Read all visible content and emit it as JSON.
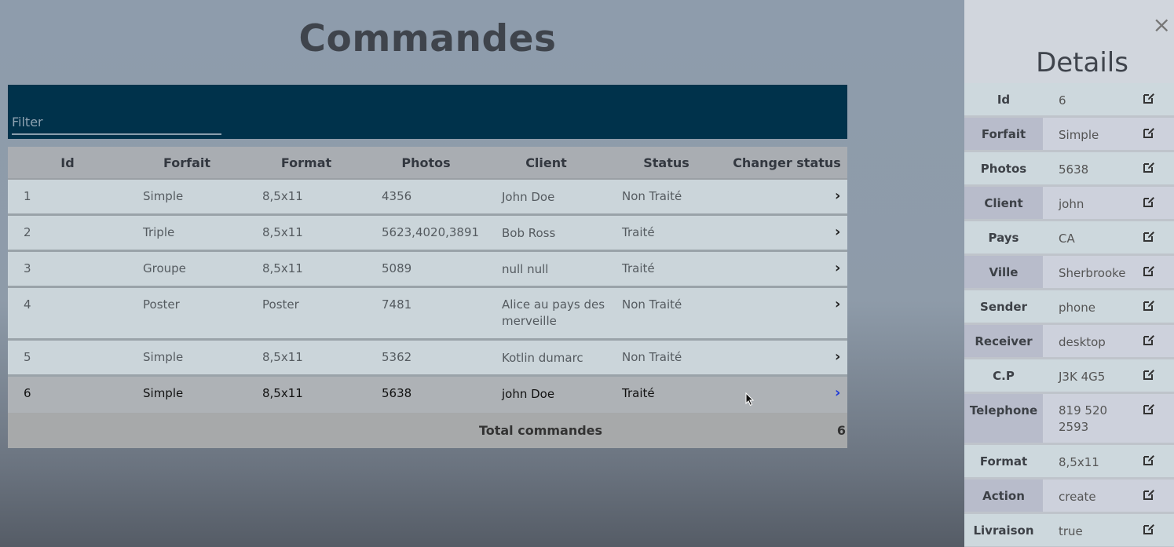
{
  "page": {
    "title": "Commandes"
  },
  "filter": {
    "placeholder": "Filter"
  },
  "table": {
    "headers": [
      "Id",
      "Forfait",
      "Format",
      "Photos",
      "Client",
      "Status",
      "Changer status"
    ],
    "rows": [
      {
        "id": "1",
        "forfait": "Simple",
        "format": "8,5x11",
        "photos": "4356",
        "client": "John Doe",
        "status": "Non Traité"
      },
      {
        "id": "2",
        "forfait": "Triple",
        "format": "8,5x11",
        "photos": "5623,4020,3891",
        "client": "Bob Ross",
        "status": "Traité"
      },
      {
        "id": "3",
        "forfait": "Groupe",
        "format": "8,5x11",
        "photos": "5089",
        "client": "null null",
        "status": "Traité"
      },
      {
        "id": "4",
        "forfait": "Poster",
        "format": "Poster",
        "photos": "7481",
        "client": "Alice au pays des merveille",
        "status": "Non Traité"
      },
      {
        "id": "5",
        "forfait": "Simple",
        "format": "8,5x11",
        "photos": "5362",
        "client": "Kotlin dumarc",
        "status": "Non Traité"
      },
      {
        "id": "6",
        "forfait": "Simple",
        "format": "8,5x11",
        "photos": "5638",
        "client": "john Doe",
        "status": "Traité"
      }
    ],
    "selected_row_id": "6",
    "footer": {
      "label": "Total commandes",
      "total": "6"
    }
  },
  "details": {
    "title": "Details",
    "close_icon": "close-icon",
    "edit_icon": "edit-icon",
    "fields": [
      {
        "key": "Id",
        "value": "6"
      },
      {
        "key": "Forfait",
        "value": "Simple"
      },
      {
        "key": "Photos",
        "value": "5638"
      },
      {
        "key": "Client",
        "value": "john"
      },
      {
        "key": "Pays",
        "value": "CA"
      },
      {
        "key": "Ville",
        "value": "Sherbrooke"
      },
      {
        "key": "Sender",
        "value": "phone"
      },
      {
        "key": "Receiver",
        "value": "desktop"
      },
      {
        "key": "C.P",
        "value": "J3K 4G5"
      },
      {
        "key": "Telephone",
        "value": "819 520 2593"
      },
      {
        "key": "Format",
        "value": "8,5x11"
      },
      {
        "key": "Action",
        "value": "create"
      },
      {
        "key": "Livraison",
        "value": "true"
      }
    ]
  },
  "colors": {
    "header_bar": "#00324b",
    "accent_chevron": "#1f3ad8"
  }
}
